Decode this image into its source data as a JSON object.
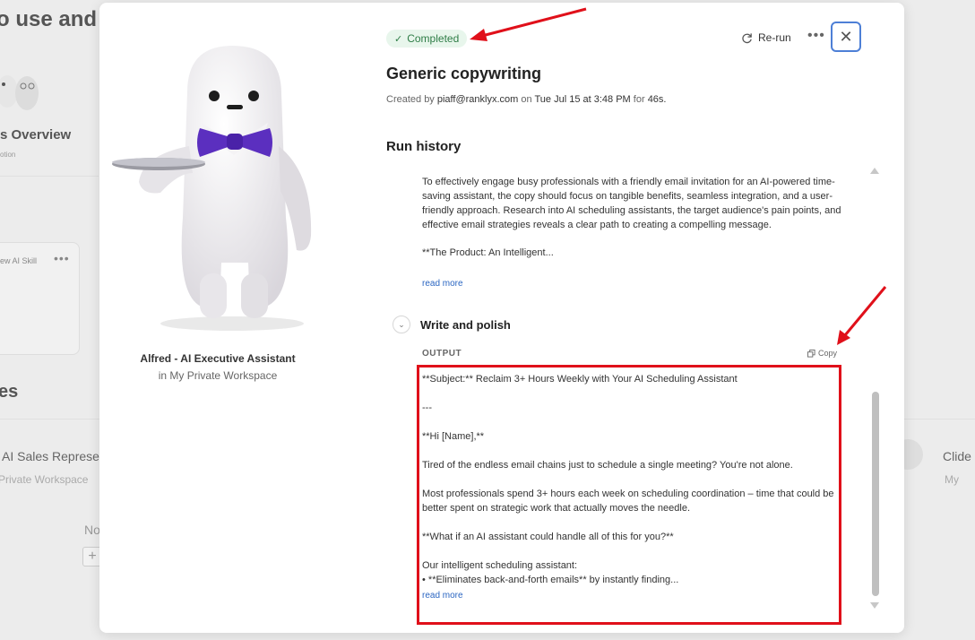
{
  "background": {
    "heading": "o use and",
    "overview": "s Overview",
    "option": "otion",
    "skill": "iew AI Skill",
    "section": "es",
    "sales": "AI Sales Represe",
    "private": "Private Workspace",
    "no": "No",
    "clide": "Clide",
    "my": "My"
  },
  "agent": {
    "name": "Alfred - AI Executive Assistant",
    "workspace": "in My Private Workspace"
  },
  "header": {
    "status": "Completed",
    "rerun_label": "Re-run",
    "more_label": "•••",
    "close_label": "✕"
  },
  "run": {
    "title": "Generic copywriting",
    "created_by_label": "Created by",
    "user": "piaff@ranklyx.com",
    "on_label": "on",
    "date": "Tue Jul 15 at 3:48 PM",
    "for_label": "for",
    "duration": "46s."
  },
  "history": {
    "heading": "Run history",
    "prev_step_paragraph": "To effectively engage busy professionals with a friendly email invitation for an AI-powered time-saving assistant, the copy should focus on tangible benefits, seamless integration, and a user-friendly approach. Research into AI scheduling assistants, the target audience's pain points, and effective email strategies reveals a clear path to creating a compelling message.",
    "prev_step_tail": "**The Product: An Intelligent...",
    "read_more": "read more",
    "step_name": "Write and polish",
    "output_label": "OUTPUT",
    "copy_label": "Copy",
    "output": {
      "line1": "**Subject:** Reclaim 3+ Hours Weekly with Your AI Scheduling Assistant",
      "line2": "---",
      "line3": "**Hi [Name],**",
      "line4": "Tired of the endless email chains just to schedule a single meeting? You're not alone.",
      "line5": "Most professionals spend 3+ hours each week on scheduling coordination – time that could be better spent on strategic work that actually moves the needle.",
      "line6": "**What if an AI assistant could handle all of this for you?**",
      "line7": "Our intelligent scheduling assistant:",
      "line8": "• **Eliminates back-and-forth emails** by instantly finding..."
    },
    "read_more_2": "read more"
  },
  "colors": {
    "status_bg": "#e8f6ec",
    "status_text": "#2f7d47",
    "link": "#2b66c2",
    "highlight": "#e0101a",
    "close_border": "#4d7fd6"
  }
}
